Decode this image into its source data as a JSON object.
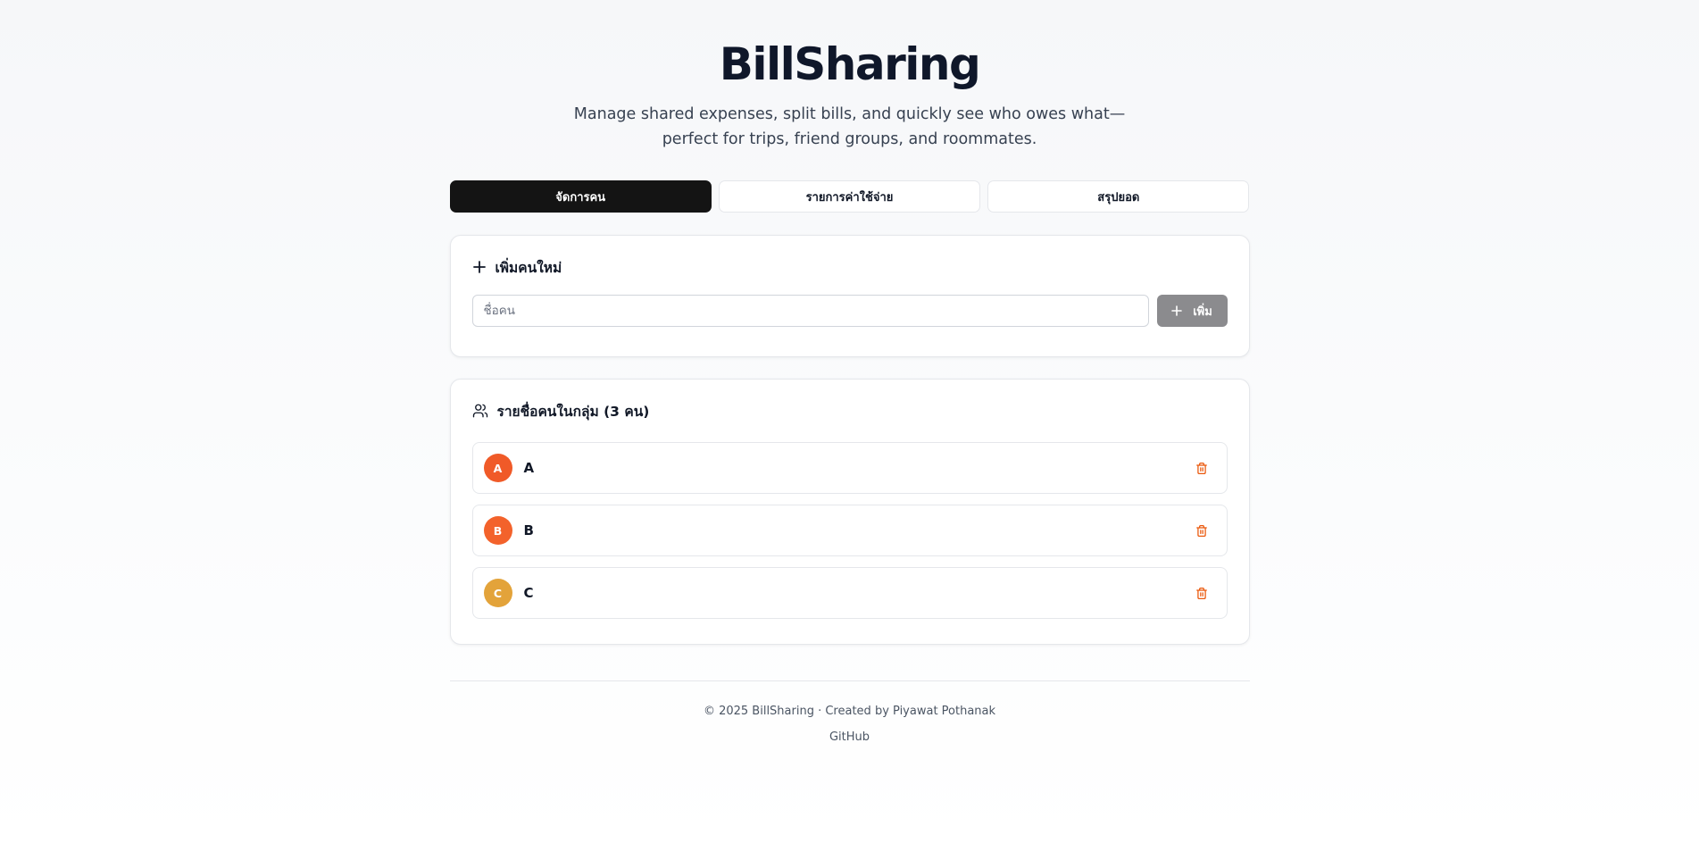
{
  "app": {
    "title": "BillSharing",
    "subtitle": "Manage shared expenses, split bills, and quickly see who owes what—perfect for trips, friend groups, and roommates."
  },
  "tabs": [
    {
      "label": "จัดการคน",
      "active": true
    },
    {
      "label": "รายการค่าใช้จ่าย",
      "active": false
    },
    {
      "label": "สรุปยอด",
      "active": false
    }
  ],
  "add_person": {
    "heading": "เพิ่มคนใหม่",
    "heading_icon": "plus-icon",
    "input_placeholder": "ชื่อคน",
    "input_value": "",
    "button_label": "เพิ่ม",
    "button_icon": "plus-icon"
  },
  "people_list": {
    "heading": "รายชื่อคนในกลุ่ม (3 คน)",
    "heading_icon": "users-icon",
    "delete_icon": "trash-icon",
    "people": [
      {
        "initial": "A",
        "name": "A",
        "color": "#f05a28"
      },
      {
        "initial": "B",
        "name": "B",
        "color": "#f3622b"
      },
      {
        "initial": "C",
        "name": "C",
        "color": "#e3a33a"
      }
    ]
  },
  "footer": {
    "copyright": "© 2025 BillSharing · Created by Piyawat Pothanak",
    "github_label": "GitHub"
  },
  "colors": {
    "tab_active_bg": "#141414",
    "delete_icon": "#ea580c",
    "add_button_bg": "#8b8b8e"
  }
}
